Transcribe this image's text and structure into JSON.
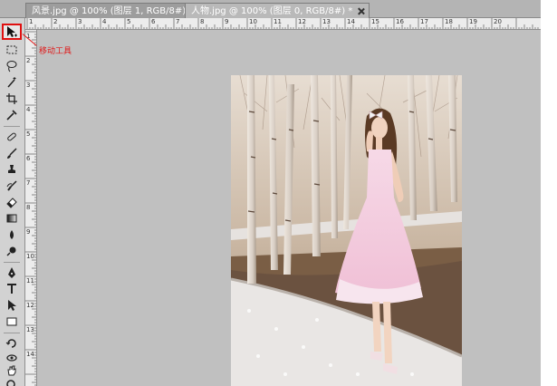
{
  "tabs": [
    {
      "label": "风景.jpg @ 100% (图层 1, RGB/8#) *",
      "active": false
    },
    {
      "label": "人物.jpg @ 100% (图层 0, RGB/8#) *",
      "active": true
    }
  ],
  "annotation": {
    "text": "移动工具"
  },
  "toolbar": {
    "selected_tool": "move-tool",
    "tools": [
      "move-tool-icon",
      "marquee-icon",
      "lasso-icon",
      "magic-wand-icon",
      "crop-icon",
      "eyedropper-icon",
      "healing-brush-icon",
      "brush-icon",
      "clone-stamp-icon",
      "history-brush-icon",
      "eraser-icon",
      "gradient-icon",
      "blur-icon",
      "dodge-icon",
      "pen-icon",
      "type-icon",
      "path-selection-icon",
      "shape-icon",
      "3d-rotate-icon",
      "3d-orbit-icon",
      "hand-icon",
      "zoom-icon",
      "color-swatches-icon"
    ]
  },
  "ruler_top": {
    "labels": [
      "1",
      "2",
      "3",
      "4",
      "5",
      "6",
      "7",
      "8",
      "9",
      "10",
      "11",
      "12",
      "13",
      "14",
      "15",
      "16",
      "17",
      "18",
      "19",
      "20"
    ]
  },
  "ruler_left": {
    "labels": [
      "1",
      "2",
      "3",
      "4",
      "5",
      "6",
      "7",
      "8",
      "9",
      "10",
      "11",
      "12",
      "13",
      "14"
    ]
  },
  "colors": {
    "annotation": "#e01818",
    "highlight": "#e01010",
    "workspace": "#c0c0c0"
  }
}
